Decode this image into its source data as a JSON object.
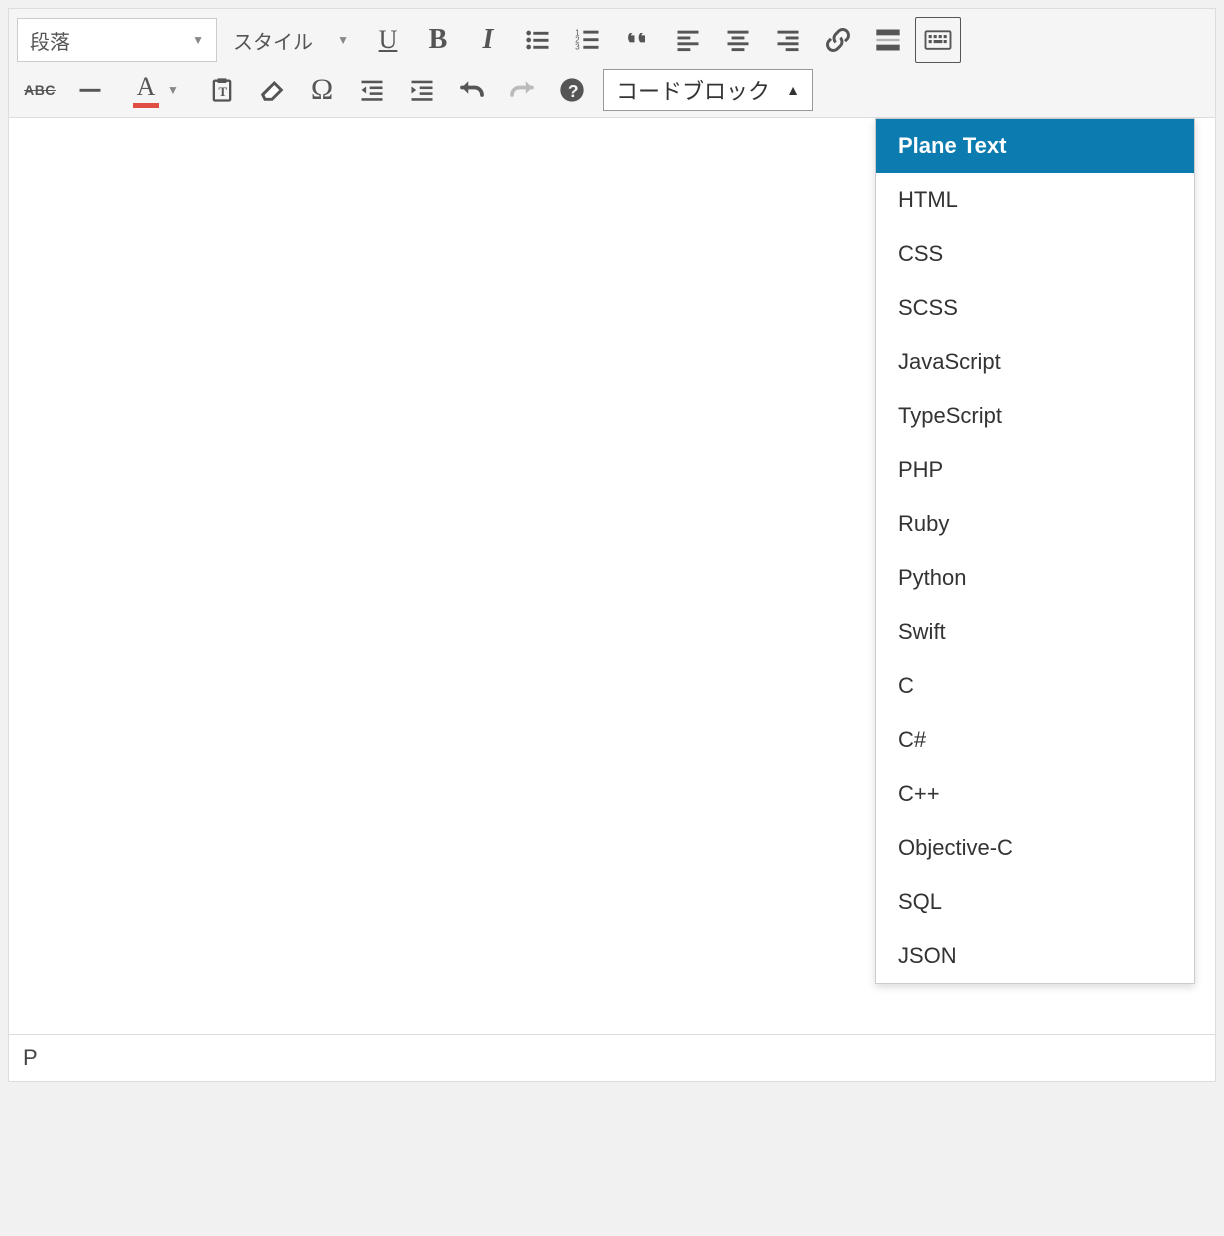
{
  "toolbar": {
    "format_select": "段落",
    "style_select": "スタイル",
    "codeblock_select": "コードブロック",
    "buttons": {
      "underline": "U",
      "bold": "B",
      "italic": "I",
      "strikethrough": "ABC",
      "textcolor": "A",
      "specialchar": "Ω"
    }
  },
  "codeblock_options": [
    "Plane Text",
    "HTML",
    "CSS",
    "SCSS",
    "JavaScript",
    "TypeScript",
    "PHP",
    "Ruby",
    "Python",
    "Swift",
    "C",
    "C#",
    "C++",
    "Objective-C",
    "SQL",
    "JSON"
  ],
  "codeblock_selected_index": 0,
  "status": {
    "path": "P"
  }
}
